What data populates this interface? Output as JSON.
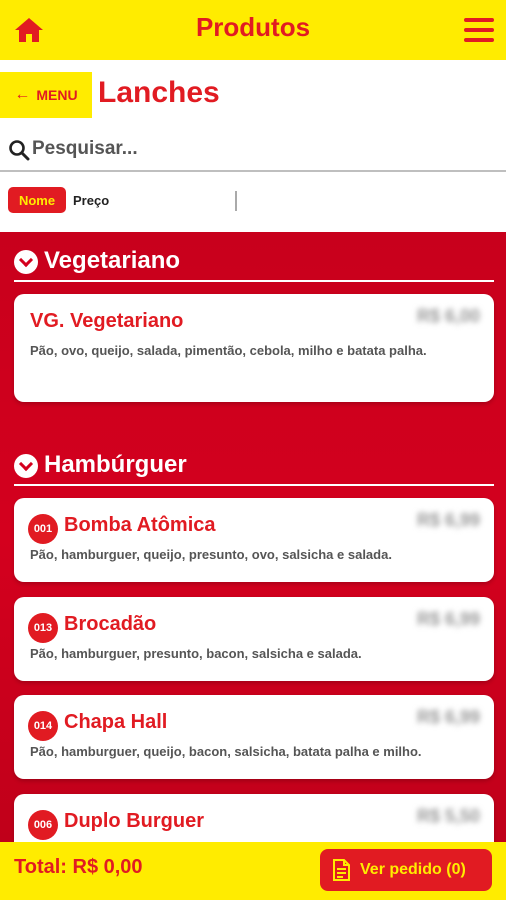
{
  "header": {
    "title": "Produtos",
    "home_icon": "home-icon",
    "menu_icon": "hamburger-menu-icon",
    "accent": "#ffec00",
    "brand": "#e11b22"
  },
  "subheader": {
    "back_label": "MENU",
    "back_icon": "arrow-left-icon",
    "page_title": "Lanches"
  },
  "search": {
    "placeholder": "Pesquisar...",
    "value": ""
  },
  "sort": {
    "options": [
      "Nome",
      "Preço"
    ],
    "selected": "Nome"
  },
  "categories": [
    {
      "label": "Vegetariano",
      "items": [
        {
          "code": "",
          "name": "VG. Vegetariano",
          "price": "R$ 6,00",
          "description": "Pão, ovo, queijo, salada, pimentão, cebola, milho e batata palha."
        }
      ]
    },
    {
      "label": "Hambúrguer",
      "items": [
        {
          "code": "001",
          "name": "Bomba Atômica",
          "price": "R$ 6,99",
          "description": "Pão, hamburguer, queijo, presunto, ovo, salsicha e salada."
        },
        {
          "code": "013",
          "name": "Brocadão",
          "price": "R$ 6,99",
          "description": "Pão, hamburguer, presunto, bacon, salsicha e salada."
        },
        {
          "code": "014",
          "name": "Chapa Hall",
          "price": "R$ 6,99",
          "description": "Pão, hamburguer, queijo, bacon, salsicha, batata palha e milho."
        },
        {
          "code": "006",
          "name": "Duplo Burguer",
          "price": "R$ 5,50",
          "description": ""
        }
      ]
    }
  ],
  "footer": {
    "total": "Total: R$ 0,00",
    "order_button": "Ver pedido (0)",
    "order_icon": "document-icon"
  }
}
